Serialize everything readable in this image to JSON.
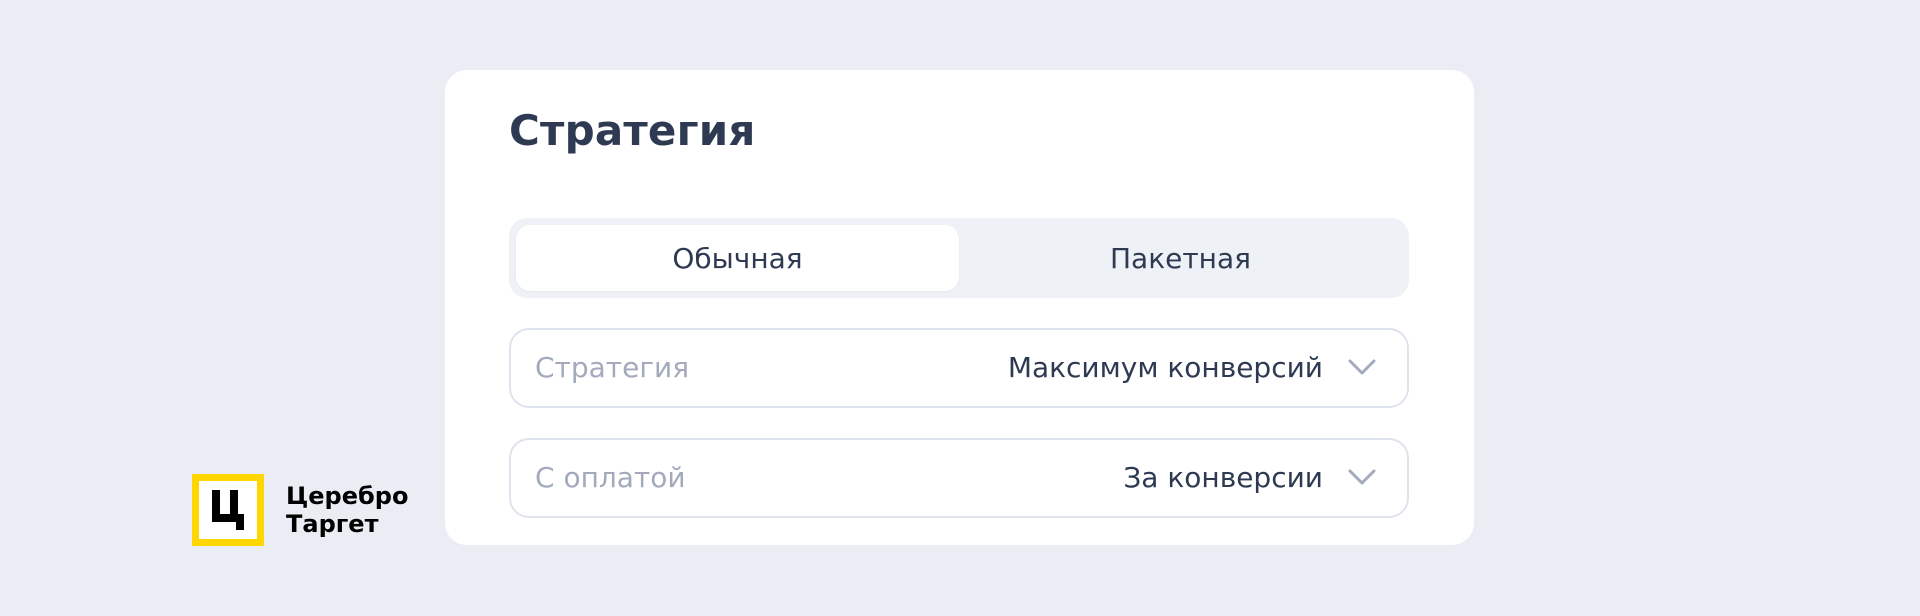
{
  "card": {
    "title": "Стратегия"
  },
  "tabs": [
    {
      "label": "Обычная",
      "active": true
    },
    {
      "label": "Пакетная",
      "active": false
    }
  ],
  "fields": [
    {
      "label": "Стратегия",
      "value": "Максимум конверсий",
      "icon": "chevron-down-icon"
    },
    {
      "label": "С оплатой",
      "value": "За конверсии",
      "icon": "chevron-down-icon"
    }
  ],
  "logo": {
    "mark": "Ц",
    "line1": "Церебро",
    "line2": "Таргет"
  },
  "colors": {
    "background": "#eaedf4",
    "card": "#ffffff",
    "text": "#2e3a52",
    "muted": "#a2aabc",
    "logo_accent": "#ffd600"
  }
}
